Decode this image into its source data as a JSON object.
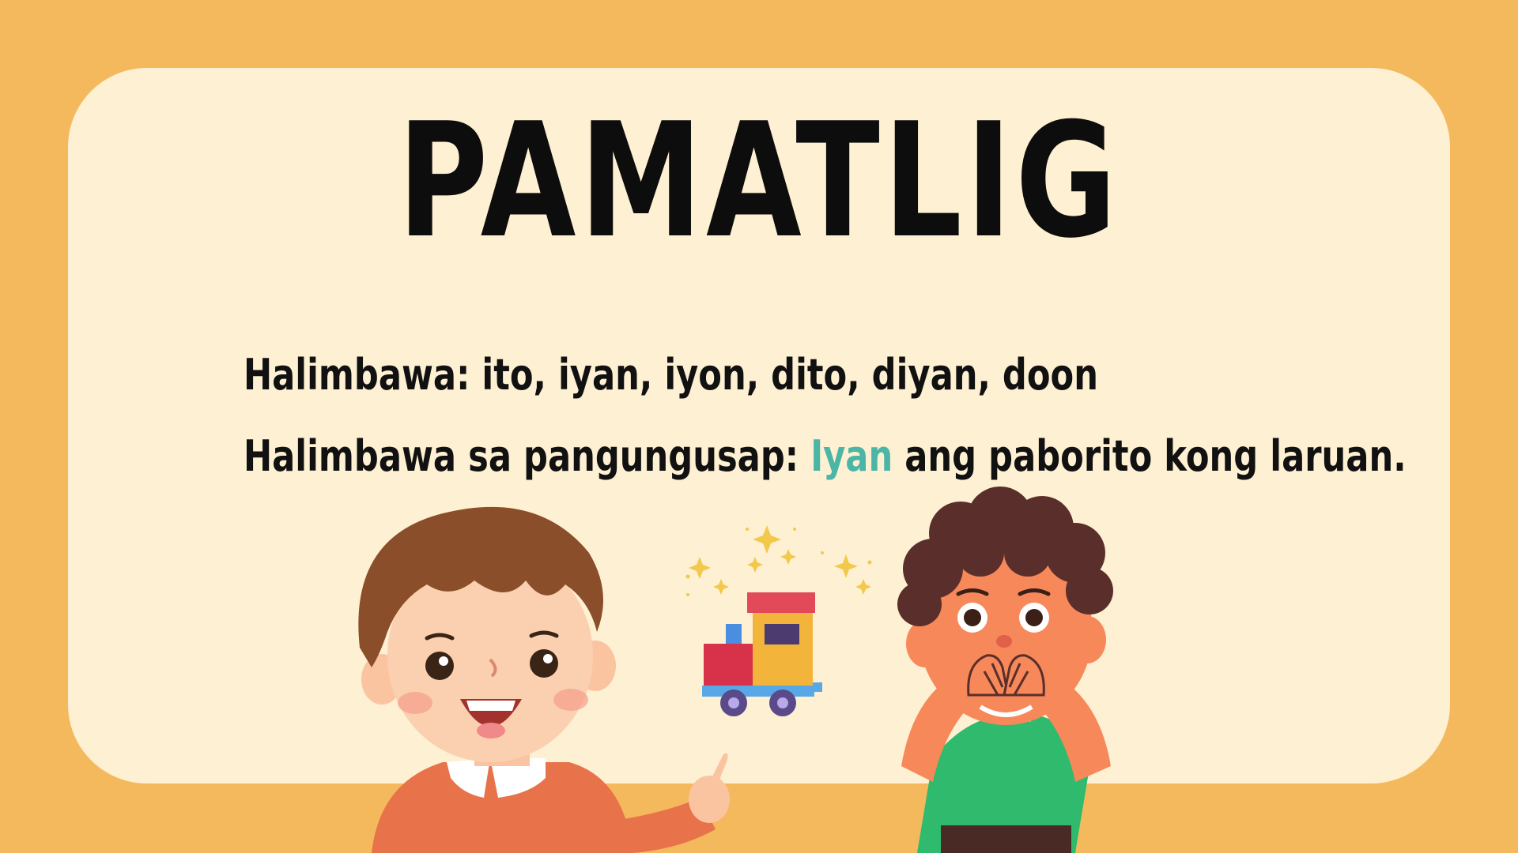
{
  "slide": {
    "title": "PAMATLIG",
    "examples_label": "Halimbawa:",
    "examples_list": "ito, iyan, iyon, dito, diyan, doon",
    "sentence_label": "Halimbawa sa pangungusap:",
    "sentence_highlight": "Iyan",
    "sentence_rest": "ang paborito kong laruan."
  },
  "colors": {
    "background": "#f4b95c",
    "card": "#fef0d2",
    "highlight": "#4bb5a6",
    "text": "#111111"
  },
  "illustrations": {
    "left_child": "pointing-boy",
    "toy": "toy-train",
    "right_child": "surprised-boy",
    "sparkles": "sparkle-icon"
  }
}
